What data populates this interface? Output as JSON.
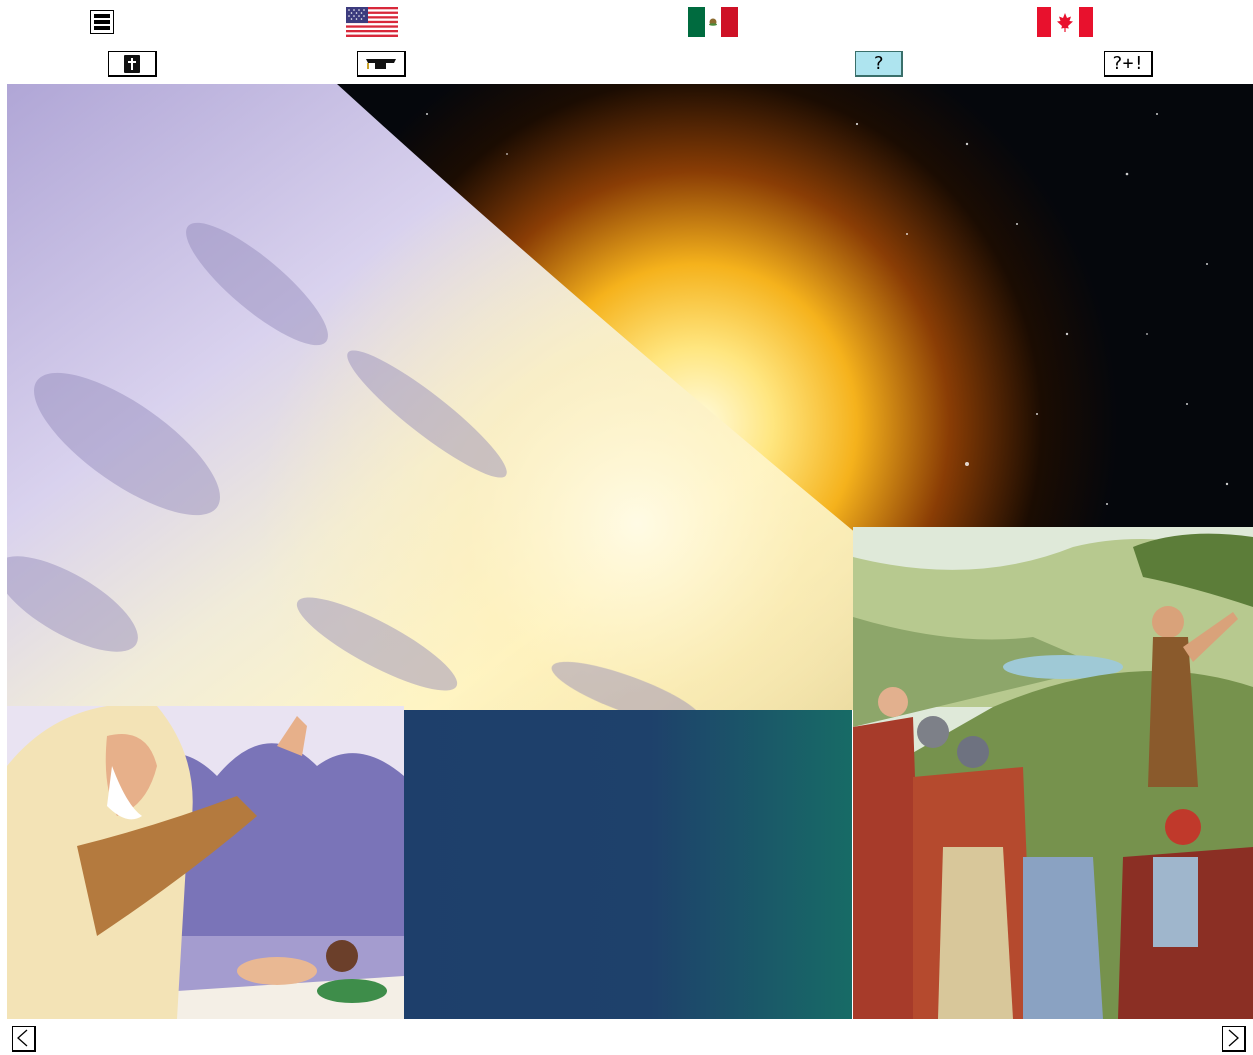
{
  "toolbar": {
    "menu_icon": "hamburger-menu-icon",
    "flags": [
      "us-flag",
      "mexico-flag",
      "canada-flag"
    ],
    "bible_icon": "bible-book-icon",
    "graduation_icon": "graduation-cap-icon",
    "question_label": "?",
    "question_plus_label": "?+!"
  },
  "colors": {
    "question_button_bg": "#aee4ef",
    "gradient_start": "#1e3f6b",
    "gradient_end": "#176b66"
  },
  "navigation": {
    "prev_icon": "chevron-left-icon",
    "next_icon": "chevron-right-icon"
  }
}
